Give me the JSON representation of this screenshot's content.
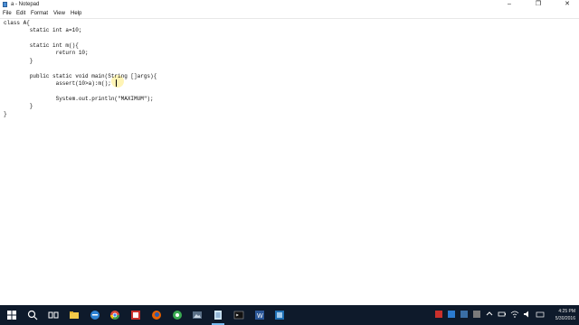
{
  "window": {
    "title": "a - Notepad",
    "minimize_glyph": "–",
    "maximize_glyph": "❐",
    "close_glyph": "✕"
  },
  "menu": {
    "file": "File",
    "edit": "Edit",
    "format": "Format",
    "view": "View",
    "help": "Help"
  },
  "code": {
    "lines": [
      "class A{",
      "",
      "        static int a=10;",
      "",
      "        static int m(){",
      "                return 10;",
      "        }",
      "",
      "        public static void main(String []args){",
      "                assert(10>a):m();",
      "",
      "                System.out.println(\"MAXIMUM\");",
      "        }",
      "}"
    ]
  },
  "taskbar": {
    "start_icon": "windows-logo-icon",
    "apps": [
      "search-icon",
      "task-view-icon",
      "file-explorer-icon",
      "edge-icon",
      "chrome-icon",
      "app-red-icon",
      "firefox-icon",
      "app-green-icon",
      "app-image-icon",
      "notepad-icon",
      "cmd-icon",
      "word-icon",
      "app-blue-icon"
    ],
    "time": "4:25 PM",
    "date": "5/30/2016"
  },
  "colors": {
    "taskbar_bg": "#0e1a2b",
    "active_indicator": "#76b9ed"
  }
}
